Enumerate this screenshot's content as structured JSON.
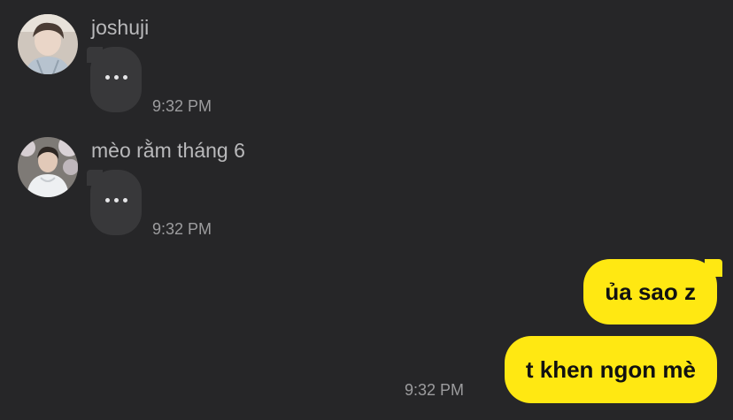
{
  "messages": [
    {
      "sender": "joshuji",
      "avatar_icon": "profile-photo-icon",
      "bubble_icon": "typing-ellipsis-icon",
      "time": "9:32 PM"
    },
    {
      "sender": "mèo rằm tháng 6",
      "avatar_icon": "profile-photo-icon",
      "bubble_icon": "typing-ellipsis-icon",
      "time": "9:32 PM"
    }
  ],
  "outgoing": {
    "messages": [
      "ủa sao z",
      "t khen ngon mè"
    ],
    "time": "9:32 PM"
  },
  "colors": {
    "background": "#262628",
    "incoming_bubble": "#38383a",
    "outgoing_bubble": "#ffe812",
    "outgoing_text": "#111111",
    "sender_name": "#b9b9bb",
    "timestamp": "#9c9c9e"
  }
}
